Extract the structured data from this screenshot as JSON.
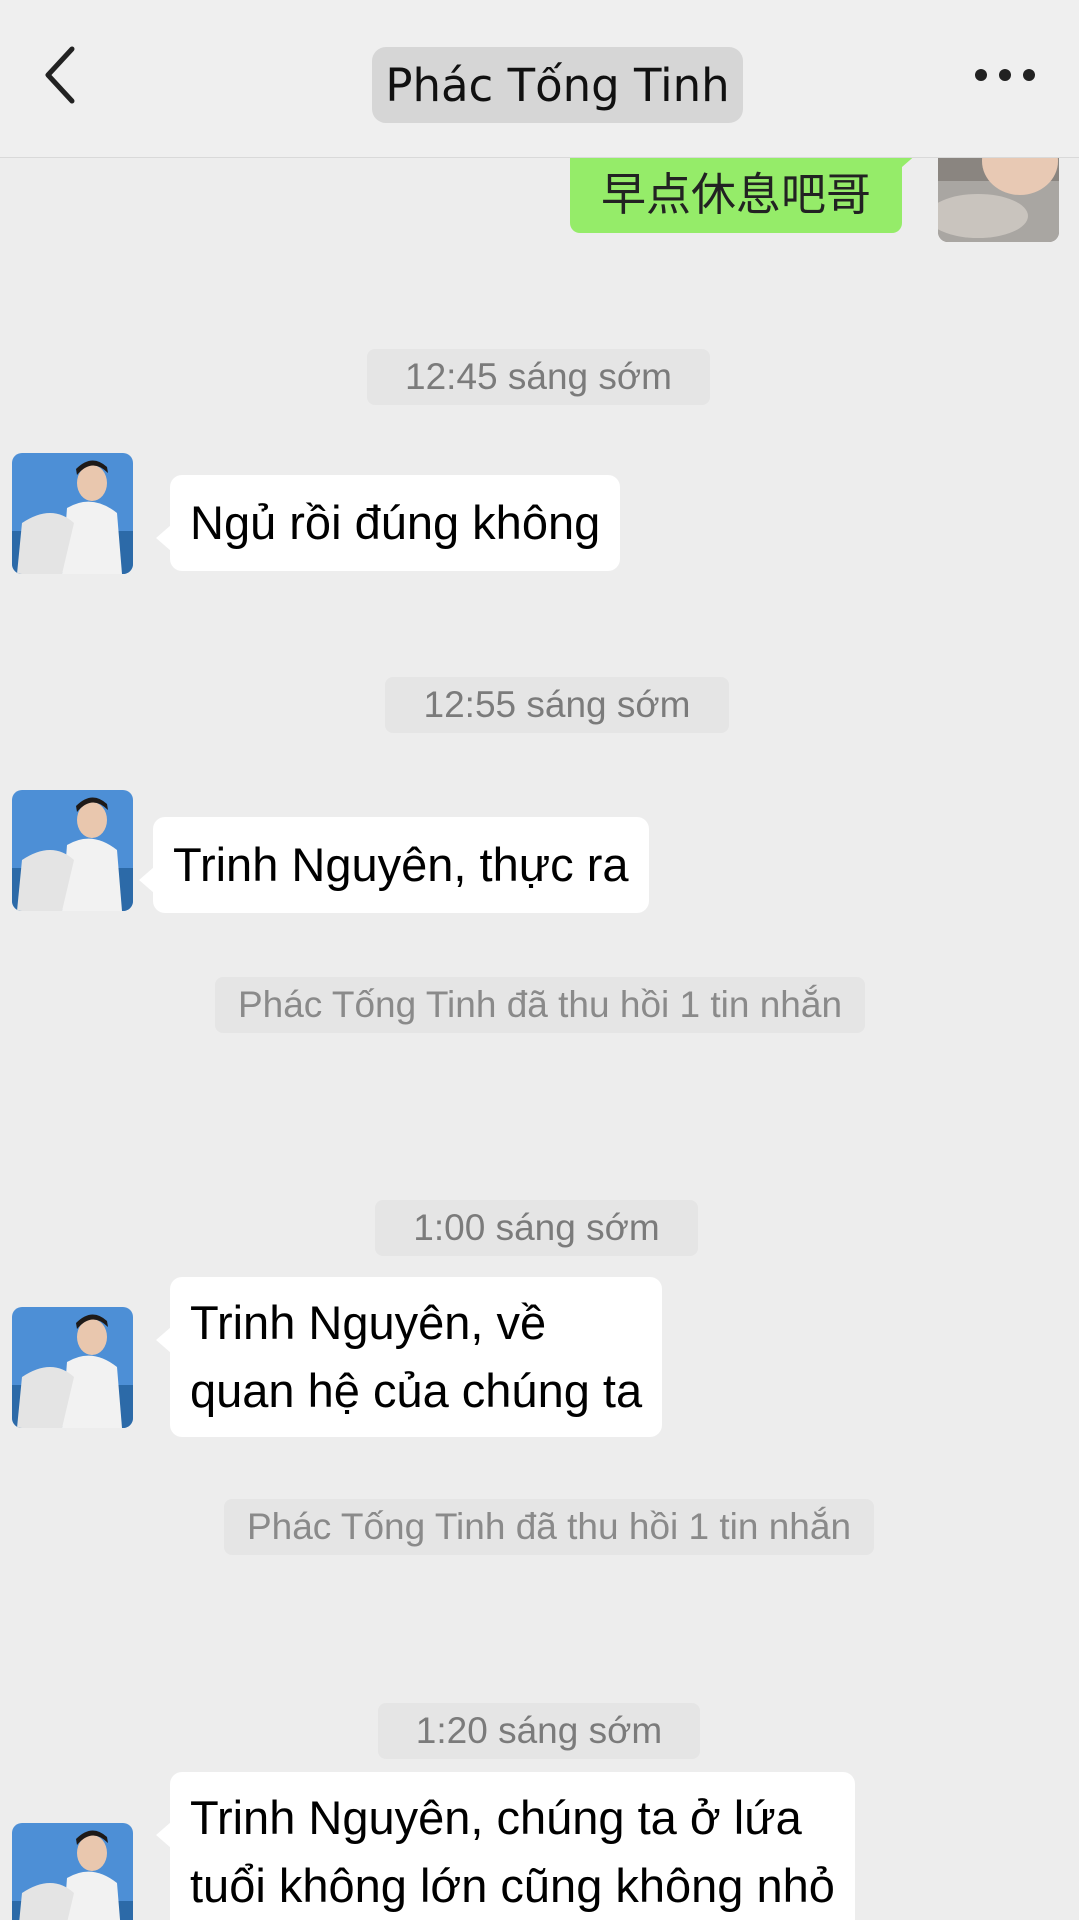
{
  "header": {
    "title": "Phác Tống Tinh",
    "back_icon": "chevron-left-icon",
    "more_icon": "more-dots-icon"
  },
  "colors": {
    "background": "#ededed",
    "incoming_bubble": "#ffffff",
    "outgoing_bubble": "#95ec69",
    "timestamp_text": "#7b7b7b"
  },
  "messages": [
    {
      "type": "outgoing",
      "text": "早点休息吧哥"
    },
    {
      "type": "timestamp",
      "text": "12:45 sáng sớm"
    },
    {
      "type": "incoming",
      "text": "Ngủ rồi đúng không"
    },
    {
      "type": "timestamp",
      "text": "12:55 sáng sớm"
    },
    {
      "type": "incoming",
      "text": "Trinh Nguyên, thực ra"
    },
    {
      "type": "system",
      "text": "Phác Tống Tinh đã thu hồi 1 tin nhắn"
    },
    {
      "type": "timestamp",
      "text": "1:00 sáng sớm"
    },
    {
      "type": "incoming",
      "lines": [
        "Trinh Nguyên, về",
        "quan hệ của chúng ta"
      ]
    },
    {
      "type": "system",
      "text": "Phác Tống Tinh đã thu hồi 1 tin nhắn"
    },
    {
      "type": "timestamp",
      "text": "1:20 sáng sớm"
    },
    {
      "type": "incoming",
      "lines": [
        "Trinh Nguyên, chúng ta ở lứa",
        "tuổi không lớn cũng không nhỏ"
      ]
    }
  ]
}
